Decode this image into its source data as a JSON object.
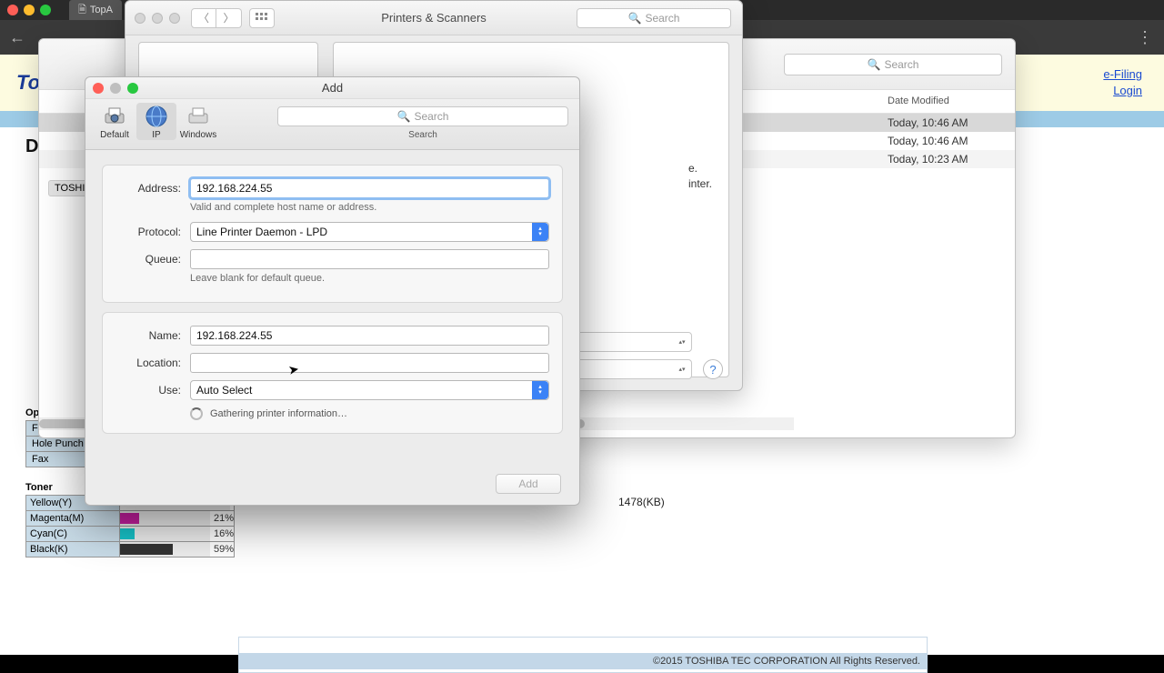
{
  "menubar": {
    "tab": "TopA"
  },
  "browser": {
    "logo": "Top",
    "links": {
      "efiling": "e-Filing",
      "login": "Login"
    },
    "D": "D"
  },
  "finder": {
    "search_ph": "Search",
    "col_date": "Date Modified",
    "rows": [
      {
        "date": "Today, 10:46 AM",
        "sel": true
      },
      {
        "date": "Today, 10:46 AM",
        "sel": false
      },
      {
        "date": "Today, 10:23 AM",
        "sel": false
      }
    ],
    "toshiba": "TOSHI"
  },
  "ps": {
    "title": "Printers & Scanners",
    "search_ph": "Search",
    "right_txt1": "e.",
    "right_txt2": "inter."
  },
  "add": {
    "title": "Add",
    "tabs": {
      "default": "Default",
      "ip": "IP",
      "windows": "Windows"
    },
    "search_ph": "Search",
    "search_lbl": "Search",
    "form": {
      "address_lbl": "Address:",
      "address_val": "192.168.224.55",
      "address_hint": "Valid and complete host name or address.",
      "protocol_lbl": "Protocol:",
      "protocol_val": "Line Printer Daemon - LPD",
      "queue_lbl": "Queue:",
      "queue_val": "",
      "queue_hint": "Leave blank for default queue.",
      "name_lbl": "Name:",
      "name_val": "192.168.224.55",
      "location_lbl": "Location:",
      "location_val": "",
      "use_lbl": "Use:",
      "use_val": "Auto Select",
      "gather": "Gathering printer information…"
    },
    "add_btn": "Add"
  },
  "options": {
    "hdr": "Options",
    "rows": [
      "Finisher",
      "Hole Punch",
      "Fax"
    ]
  },
  "toner": {
    "hdr": "Toner",
    "rows": [
      {
        "name": "Yellow(Y)",
        "pct": "",
        "fill": 0,
        "color": "#f7d917"
      },
      {
        "name": "Magenta(M)",
        "pct": "21%",
        "fill": 21,
        "color": "#c71fa1"
      },
      {
        "name": "Cyan(C)",
        "pct": "16%",
        "fill": 16,
        "color": "#17c3c9"
      },
      {
        "name": "Black(K)",
        "pct": "59%",
        "fill": 59,
        "color": "#333"
      }
    ]
  },
  "page_size": "1478(KB)",
  "footer": "©2015 TOSHIBA TEC CORPORATION All Rights Reserved."
}
